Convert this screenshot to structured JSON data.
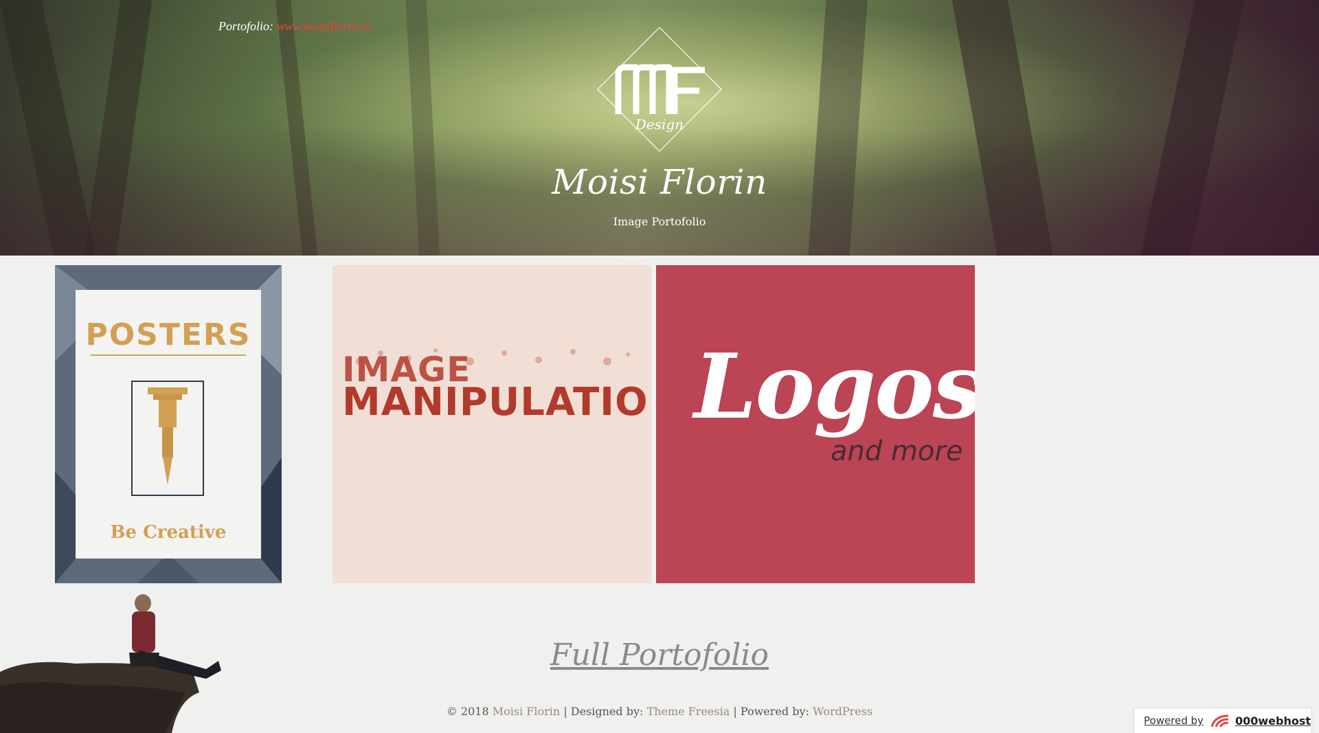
{
  "header": {
    "portfolio_label": "Portofolio:",
    "portfolio_link": "www.moisiflorin.ro",
    "site_title": "Moisi Florin",
    "site_description": "Image Portofolio",
    "logo_letters": "MF",
    "logo_script": "Design"
  },
  "tiles": {
    "posters": {
      "title": "POSTERS",
      "subtitle": "Be Creative"
    },
    "manipulation": {
      "line1": "IMAGE",
      "line2": "MANIPULATION"
    },
    "logos": {
      "title": "Logos",
      "subtitle": "and more"
    }
  },
  "footer": {
    "full_portfolio": "Full Portofolio",
    "copyright": "© 2018",
    "owner_link": "Moisi Florin",
    "designed_by_label": "| Designed by:",
    "theme_link": "Theme Freesia",
    "powered_by_label": "| Powered by:",
    "wp_link": "WordPress"
  },
  "badge": {
    "label": "Powered by",
    "brand": "000webhost"
  },
  "colors": {
    "accent_link": "#e6453c",
    "poster_gold": "#d2a053",
    "logos_bg": "#bb4455",
    "manip_bg": "#f1dfd5"
  }
}
